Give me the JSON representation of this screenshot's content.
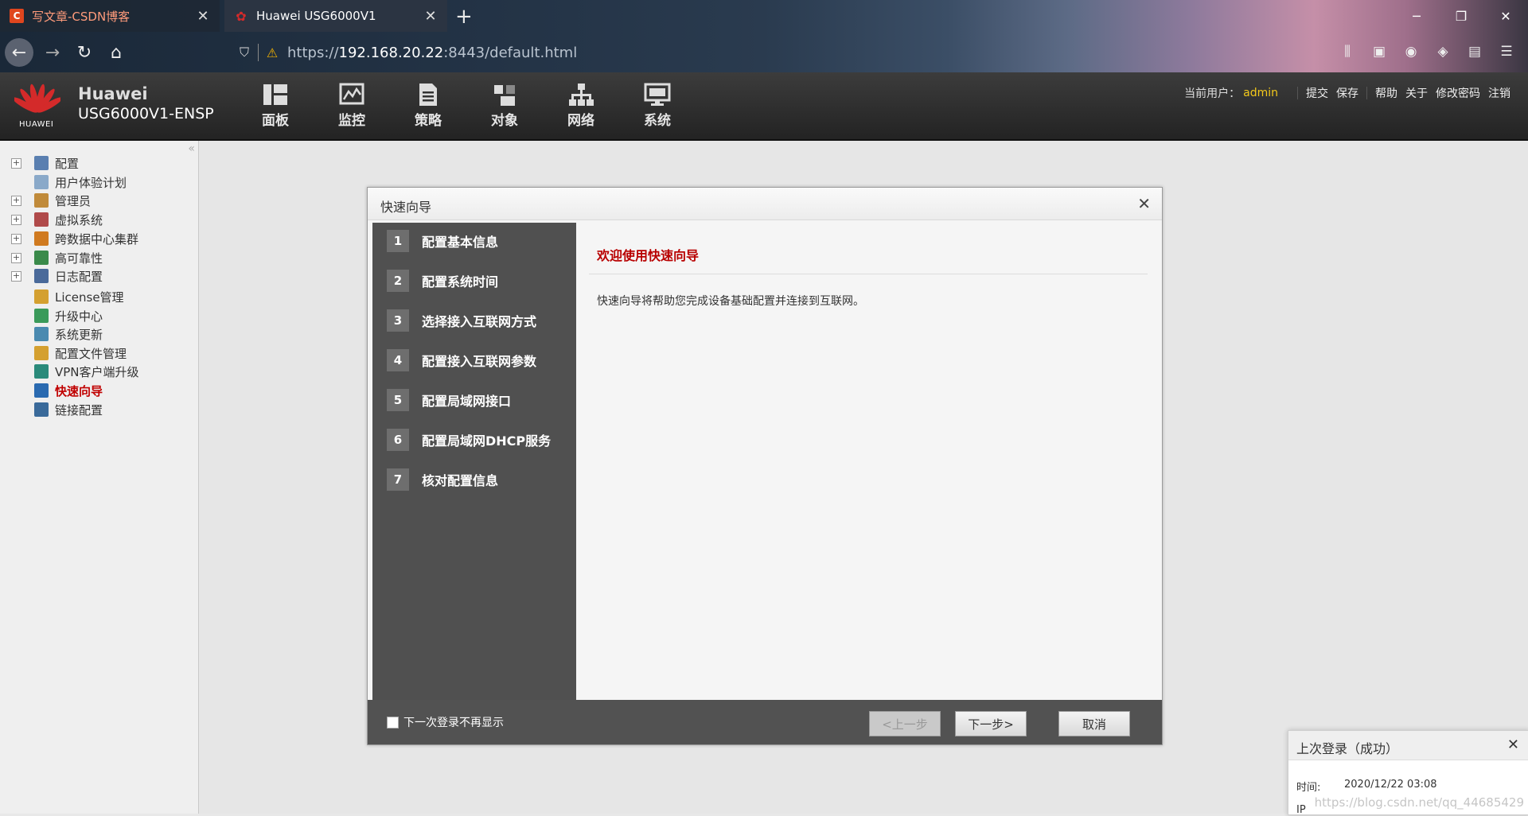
{
  "browser": {
    "tabs": [
      {
        "title": "写文章-CSDN博客",
        "favicon": "csdn-c-icon",
        "favicon_text": "C"
      },
      {
        "title": "Huawei USG6000V1",
        "favicon": "huawei-flower-icon",
        "favicon_text": "✿"
      }
    ],
    "url": {
      "scheme": "https://",
      "host": "192.168.20.22",
      "rest": ":8443/default.html"
    },
    "colors": {
      "accent": "#d42a2a"
    }
  },
  "header": {
    "brand_name": "Huawei",
    "model": "USG6000V1-ENSP",
    "logo_label": "HUAWEI",
    "nav": [
      {
        "label": "面板",
        "icon": "dashboard-icon"
      },
      {
        "label": "监控",
        "icon": "monitor-icon"
      },
      {
        "label": "策略",
        "icon": "policy-icon"
      },
      {
        "label": "对象",
        "icon": "object-icon"
      },
      {
        "label": "网络",
        "icon": "network-icon"
      },
      {
        "label": "系统",
        "icon": "system-icon"
      }
    ],
    "user_label": "当前用户：",
    "user_name": "admin",
    "links": [
      "提交",
      "保存",
      "帮助",
      "关于",
      "修改密码",
      "注销"
    ],
    "user_color": "#f3c81a"
  },
  "sidebar": {
    "items": [
      {
        "label": "配置",
        "expandable": true,
        "icon_color": "#5a7fb0"
      },
      {
        "label": "用户体验计划",
        "expandable": false,
        "icon_color": "#8aa9c9"
      },
      {
        "label": "管理员",
        "expandable": true,
        "icon_color": "#c08a3a"
      },
      {
        "label": "虚拟系统",
        "expandable": true,
        "icon_color": "#b04a4a"
      },
      {
        "label": "跨数据中心集群",
        "expandable": true,
        "icon_color": "#d07a20"
      },
      {
        "label": "高可靠性",
        "expandable": true,
        "icon_color": "#3a8a4a"
      },
      {
        "label": "日志配置",
        "expandable": true,
        "icon_color": "#4a6a9a"
      },
      {
        "label": "License管理",
        "expandable": false,
        "icon_color": "#d4a030"
      },
      {
        "label": "升级中心",
        "expandable": false,
        "icon_color": "#3a9a5a"
      },
      {
        "label": "系统更新",
        "expandable": false,
        "icon_color": "#4a8ab0"
      },
      {
        "label": "配置文件管理",
        "expandable": false,
        "icon_color": "#d4a030"
      },
      {
        "label": "VPN客户端升级",
        "expandable": false,
        "icon_color": "#2a8a7a"
      },
      {
        "label": "快速向导",
        "expandable": false,
        "icon_color": "#2a6ab0",
        "selected": true
      },
      {
        "label": "链接配置",
        "expandable": false,
        "icon_color": "#3a6a9a"
      }
    ],
    "selected_color": "#c00000"
  },
  "dialog": {
    "title": "快速向导",
    "steps": [
      {
        "num": "1",
        "label": "配置基本信息"
      },
      {
        "num": "2",
        "label": "配置系统时间"
      },
      {
        "num": "3",
        "label": "选择接入互联网方式"
      },
      {
        "num": "4",
        "label": "配置接入互联网参数"
      },
      {
        "num": "5",
        "label": "配置局域网接口"
      },
      {
        "num": "6",
        "label": "配置局域网DHCP服务"
      },
      {
        "num": "7",
        "label": "核对配置信息"
      }
    ],
    "welcome_title": "欢迎使用快速向导",
    "welcome_text": "快速向导将帮助您完成设备基础配置并连接到互联网。",
    "dont_show_label": "下一次登录不再显示",
    "prev_label": "<上一步",
    "next_label": "下一步>",
    "cancel_label": "取消",
    "title_color": "#b80000"
  },
  "toast": {
    "title": "上次登录（成功）",
    "time_label": "时间:",
    "time_value": "2020/12/22 03:08",
    "ip_label": "IP"
  },
  "watermark": "https://blog.csdn.net/qq_44685429"
}
